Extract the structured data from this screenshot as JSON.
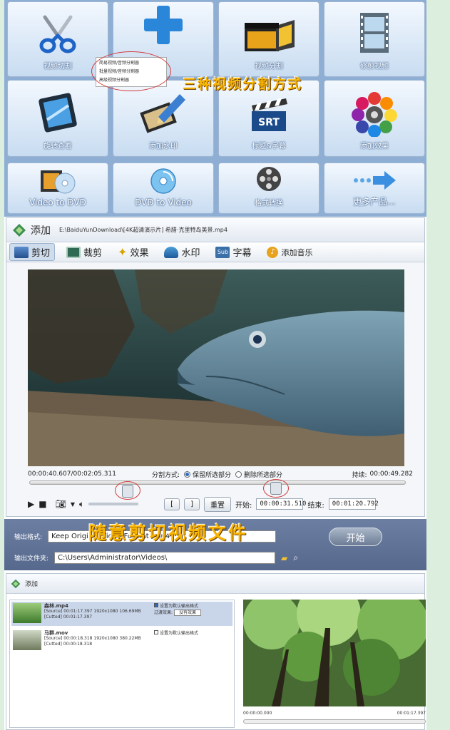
{
  "tiles": [
    {
      "label": "视频切割",
      "icon": "scissors-icon"
    },
    {
      "label": "",
      "icon": "plus-icon"
    },
    {
      "label": "视频分割",
      "icon": "film-clapper-icon"
    },
    {
      "label": "修剪视频",
      "icon": "film-strip-icon"
    },
    {
      "label": "旋转查看",
      "icon": "film-reel-icon"
    },
    {
      "label": "添加水印",
      "icon": "pencil-film-icon"
    },
    {
      "label": "标题&字幕",
      "icon": "srt-icon"
    },
    {
      "label": "添加效果",
      "icon": "palette-icon"
    },
    {
      "label": "Video to DVD",
      "icon": "dvd-film-icon"
    },
    {
      "label": "DVD to Video",
      "icon": "dvd-disc-icon"
    },
    {
      "label": "格式转换",
      "icon": "format-reel-icon"
    },
    {
      "label": "更多产品...",
      "icon": "arrow-right-icon"
    }
  ],
  "popup_menu": [
    "简易视频/音频分割器",
    "批量视频/音频分割器",
    "高级视频分割器"
  ],
  "captions": {
    "top": "三种视频分割方式",
    "middle": "随意剪切视频文件"
  },
  "editor": {
    "app_label": "添加",
    "file_path": "E:\\BaiduYunDownload\\[4K超清演示片] 希腊·克里特岛美景.mp4",
    "tabs": [
      "剪切",
      "裁剪",
      "效果",
      "水印",
      "字幕",
      "添加音乐"
    ],
    "time_current": "00:00:40.607/00:02:05.311",
    "split_label": "分割方式:",
    "split_keep": "保留所选部分",
    "split_delete": "删除所选部分",
    "duration_label": "持续:",
    "duration_value": "00:00:49.282",
    "bracket_open": "[",
    "bracket_close": "]",
    "reset": "重置",
    "start_label": "开始:",
    "start_value": "00:00:31.510",
    "end_label": "结束:",
    "end_value": "00:01:20.792"
  },
  "output": {
    "format_label": "输出格式:",
    "format_value": "Keep Original Video Format (mp4)",
    "folder_label": "输出文件夹:",
    "folder_value": "C:\\Users\\Administrator\\Videos\\",
    "start_button": "开始"
  },
  "batch": {
    "title": "添加",
    "files": [
      {
        "name": "森林.mp4",
        "source": "[Source]  00:01:17.397  1920x1080  106.69MB",
        "cutted": "[Cutted]  00:01:17.397",
        "default_opt": "设置为默认输出格式",
        "transition_label": "过渡效果:",
        "transition_value": "没有效果"
      },
      {
        "name": "马群.mov",
        "source": "[Source]  00:00:18.318  1920x1080  380.22MB",
        "cutted": "[Cutted]  00:00:18.318",
        "default_opt": "设置为默认输出格式"
      }
    ],
    "preview_start": "00:00:00.000",
    "preview_end": "00:01:17.397"
  },
  "colors": {
    "accent": "#2c6bc0",
    "caption": "#f8b400",
    "highlight_ring": "#d23b3b",
    "tile_bg": "#8eaed4"
  }
}
